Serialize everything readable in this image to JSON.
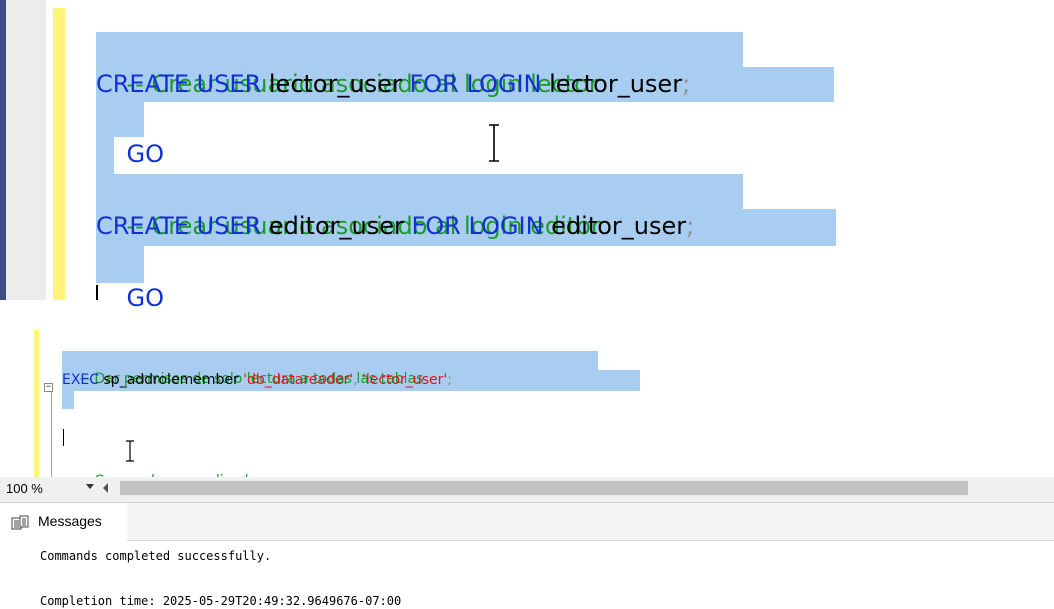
{
  "editor_zoomed": {
    "lines": [
      {
        "comment": "-- Crear usuario asociado al login lector"
      },
      {
        "kw1": "CREATE USER",
        "ident1": " lector_user ",
        "kw2": "FOR LOGIN",
        "ident2": " lector_user",
        "semi": ";"
      },
      {
        "kw": "GO"
      },
      {
        "comment": "-- Crear usuario asociado al login editor"
      },
      {
        "kw1": "CREATE USER",
        "ident1": " editor_user ",
        "kw2": "FOR LOGIN",
        "ident2": " editor_user",
        "semi": ";"
      },
      {
        "kw": "GO"
      }
    ]
  },
  "editor": {
    "comment1": "-- Dar permisos de solo lectura a todas las tablas",
    "exec_kw": "EXEC",
    "proc_name": " sp_addrolemember ",
    "arg1": "'db_datareader'",
    "comma": ", ",
    "arg2": "'lector_user'",
    "semi": ";",
    "comment2": "-- Crear rol personalizado",
    "collapse_glyph": "−"
  },
  "toolbar": {
    "zoom": "100 %"
  },
  "messages": {
    "tab_label": "Messages",
    "line1": "Commands completed successfully.",
    "line2": "Completion time: 2025-05-29T20:49:32.9649676-07:00"
  },
  "colors": {
    "keyword": "#1230d4",
    "comment": "#1b9a2c",
    "string": "#e0141c",
    "selection": "#a8cdf1",
    "change_margin": "#fff37a"
  }
}
